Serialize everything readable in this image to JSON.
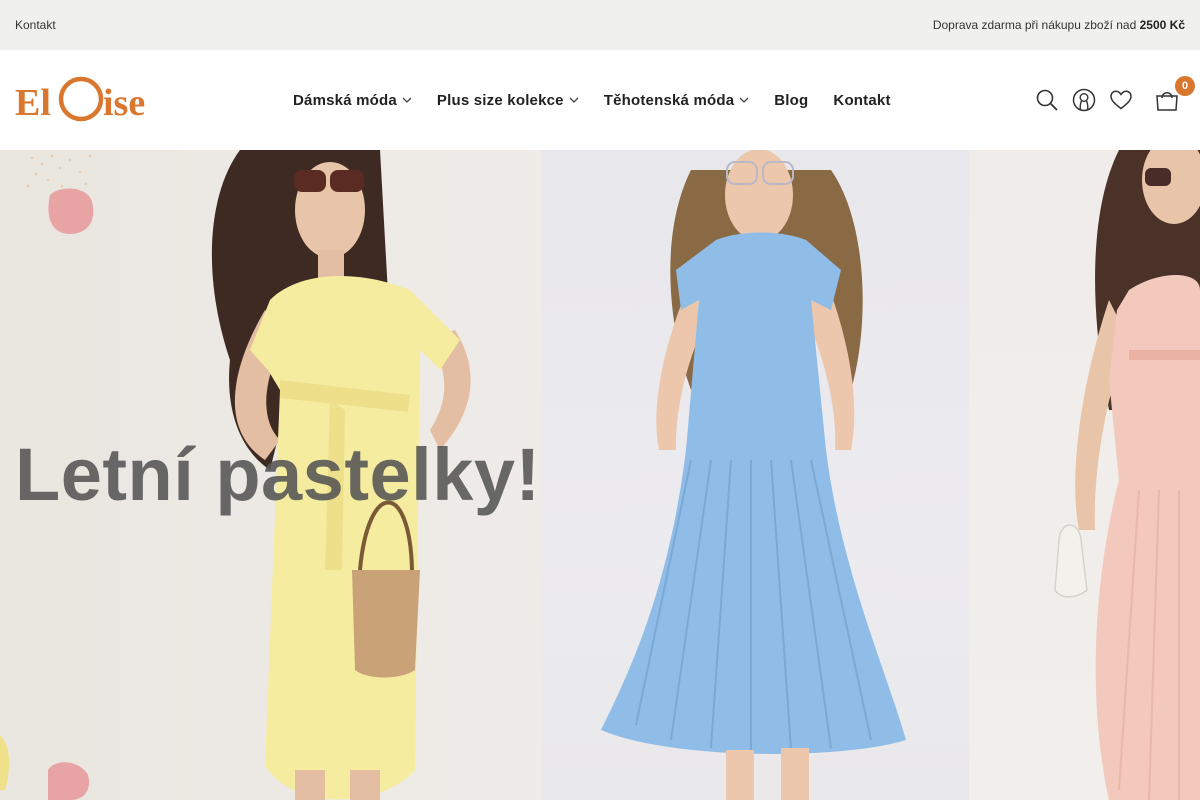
{
  "topbar": {
    "contact_link": "Kontakt",
    "shipping_text": "Doprava zdarma při nákupu zboží nad",
    "shipping_threshold": "2500 Kč"
  },
  "header": {
    "logo_text": "ElOise",
    "brand_color": "#d9772f",
    "nav": [
      {
        "label": "Dámská móda",
        "has_dropdown": true
      },
      {
        "label": "Plus size kolekce",
        "has_dropdown": true
      },
      {
        "label": "Těhotenská móda",
        "has_dropdown": true
      },
      {
        "label": "Blog",
        "has_dropdown": false
      },
      {
        "label": "Kontakt",
        "has_dropdown": false
      }
    ],
    "icons": [
      "search-icon",
      "user-icon",
      "heart-icon",
      "cart-icon"
    ],
    "cart_count": "0"
  },
  "hero": {
    "title": "Letní pastelky!",
    "dress_colors": [
      "#f5eca0",
      "#8fbde8",
      "#f3c8bd"
    ]
  }
}
